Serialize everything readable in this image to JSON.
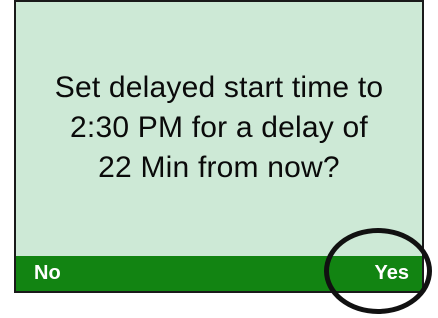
{
  "dialog": {
    "message_lines": [
      "Set delayed start time to",
      "2:30 PM for a delay of",
      "22 Min from now?"
    ]
  },
  "softkeys": {
    "left_label": "No",
    "right_label": "Yes"
  },
  "colors": {
    "screen_background": "#cde9d6",
    "softkey_bar": "#128412",
    "softkey_text": "#ffffff",
    "highlight_ring": "#111111"
  }
}
